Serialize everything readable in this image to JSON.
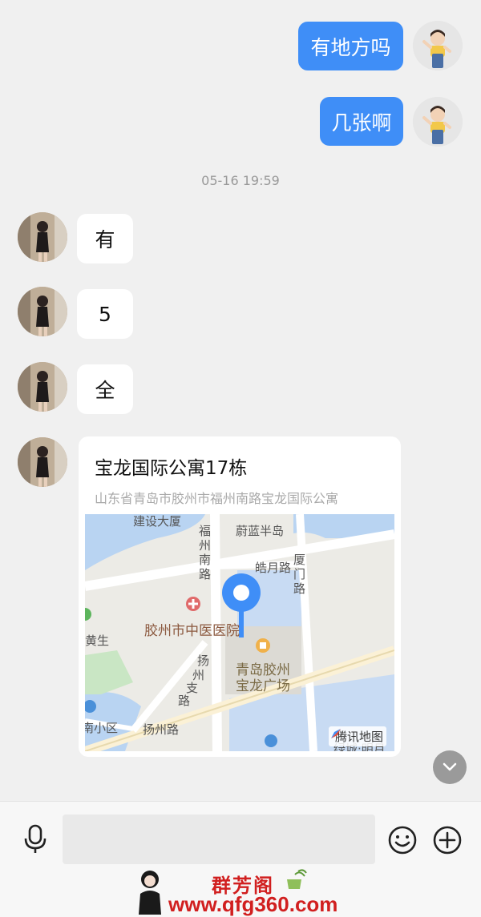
{
  "messages_outgoing": [
    {
      "text": "有地方吗"
    },
    {
      "text": "几张啊"
    }
  ],
  "timestamp": "05-16 19:59",
  "messages_incoming": [
    {
      "text": "有"
    },
    {
      "text": "5"
    },
    {
      "text": "全"
    }
  ],
  "location_card": {
    "title": "宝龙国际公寓17栋",
    "address": "山东省青岛市胶州市福州南路宝龙国际公寓",
    "map_labels": {
      "jianshe": "建设大厦",
      "fuzhou_1": "福",
      "fuzhou_2": "州",
      "fuzhou_3": "南",
      "fuzhou_4": "路",
      "weilan": "蔚蓝半岛",
      "haoyue": "皓月路",
      "xiamen_1": "厦",
      "xiamen_2": "门",
      "xiamen_3": "路",
      "hospital": "胶州市中医医院",
      "huangsheng": "黄生",
      "yangzhou_zhi_1": "扬",
      "yangzhou_zhi_2": "州",
      "yangzhou_zhi_3": "支",
      "yangzhou_zhi_4": "路",
      "plaza_line1": "青岛胶州",
      "plaza_line2": "宝龙广场",
      "xiaoqu": "南小区",
      "yangzhou_road": "扬州路",
      "lvcheng": "绿城·明月"
    },
    "attribution": "腾讯地图"
  },
  "input_bar": {
    "placeholder": ""
  },
  "watermark": {
    "title": "群芳阁",
    "url": "www.qfg360.com"
  },
  "colors": {
    "outgoing_bubble": "#3f8ef7",
    "incoming_bubble": "#ffffff",
    "chat_background": "#f0f0f0",
    "map_pin": "#3f8ef7",
    "watermark": "#d11f1f"
  }
}
